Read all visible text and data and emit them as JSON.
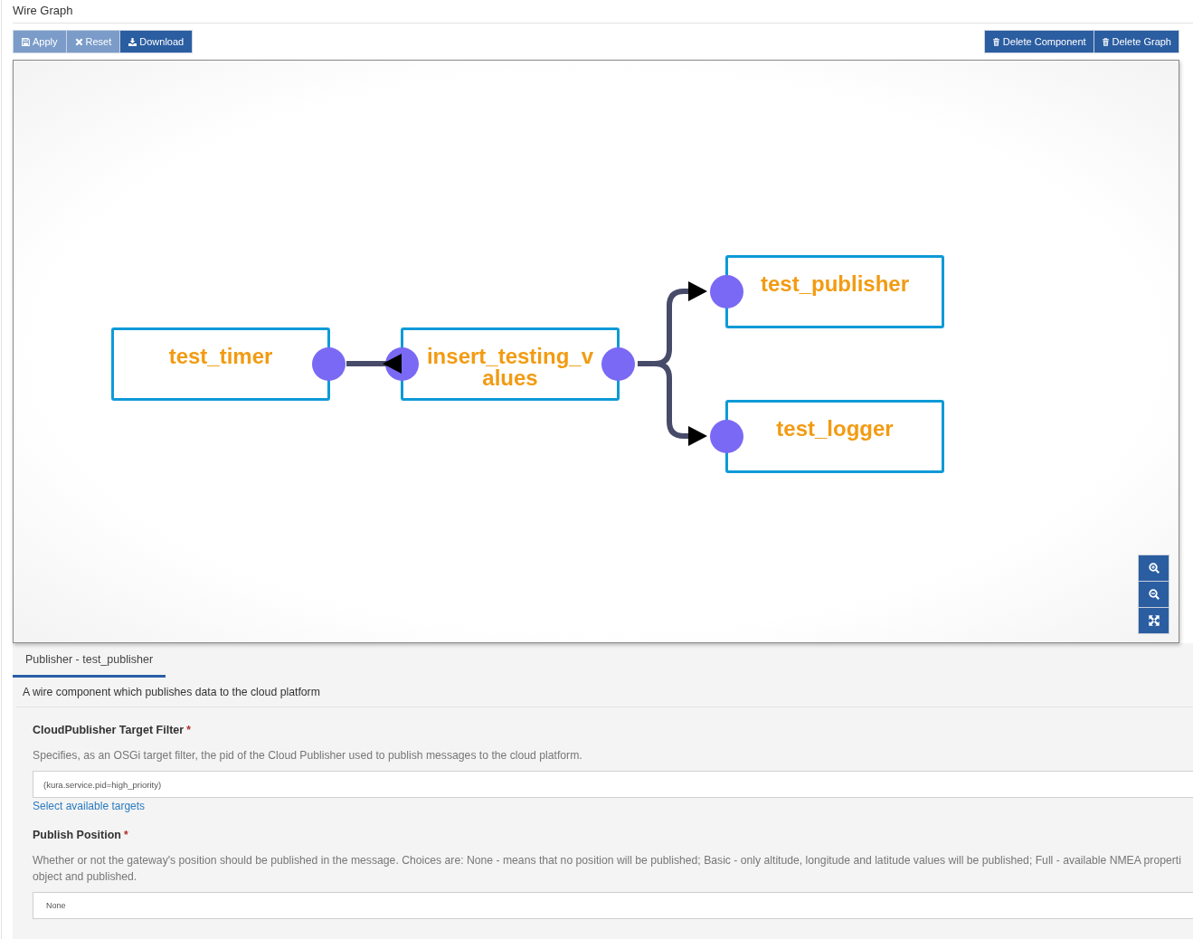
{
  "page": {
    "title": "Wire Graph"
  },
  "toolbar": {
    "left": [
      {
        "label": "Apply",
        "kind": "save",
        "disabled": true
      },
      {
        "label": "Reset",
        "kind": "reset",
        "disabled": true
      },
      {
        "label": "Download",
        "kind": "download",
        "disabled": false
      }
    ],
    "right": [
      {
        "label": "Delete Component",
        "kind": "delete",
        "disabled": false
      },
      {
        "label": "Delete Graph",
        "kind": "delete",
        "disabled": false
      }
    ]
  },
  "graph": {
    "nodes": [
      {
        "name": "test_timer",
        "input_port": false,
        "output_port": true
      },
      {
        "name": "insert_testing_values",
        "input_port": true,
        "output_port": true
      },
      {
        "name": "test_publisher",
        "input_port": true,
        "output_port": false
      },
      {
        "name": "test_logger",
        "input_port": true,
        "output_port": false
      }
    ]
  },
  "details": {
    "tabs": [
      {
        "label": "Publisher - test_publisher",
        "selected": true
      }
    ],
    "component_description": "A wire component which publishes data to the cloud platform",
    "fields": [
      {
        "kind": "text",
        "label": "CloudPublisher Target Filter",
        "required_mark": "*",
        "description_lines": [
          "Specifies, as an OSGi target filter, the pid of the Cloud Publisher used to publish messages to the cloud platform."
        ],
        "value": "(kura.service.pid=high_priority)",
        "link": "Select available targets"
      },
      {
        "kind": "select",
        "label": "Publish Position",
        "required_mark": "*",
        "description_lines": [
          "Whether or not the gateway's position should be published in the message. Choices are: None - means that no position will be published; Basic - only altitude, longitude and latitude values will be published; Full - available NMEA properti",
          "object and published."
        ],
        "value": "None"
      }
    ]
  }
}
